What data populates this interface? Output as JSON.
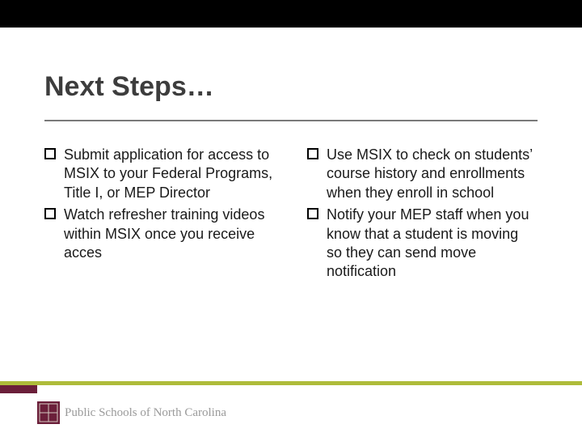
{
  "title": "Next Steps…",
  "columns": {
    "left": {
      "items": [
        "Submit application for access to MSIX to your Federal Programs, Title I, or MEP Director",
        "Watch refresher training videos within MSIX once you receive acces"
      ]
    },
    "right": {
      "items": [
        "Use MSIX to check on students’ course history and enrollments when they enroll in school",
        "Notify your MEP staff when you know that a student is moving so they can send move notification"
      ]
    }
  },
  "footer": {
    "brand": "Public Schools of North Carolina"
  },
  "colors": {
    "olive": "#aebc3a",
    "maroon": "#6b1f3a",
    "rule": "#7a7a7a"
  }
}
